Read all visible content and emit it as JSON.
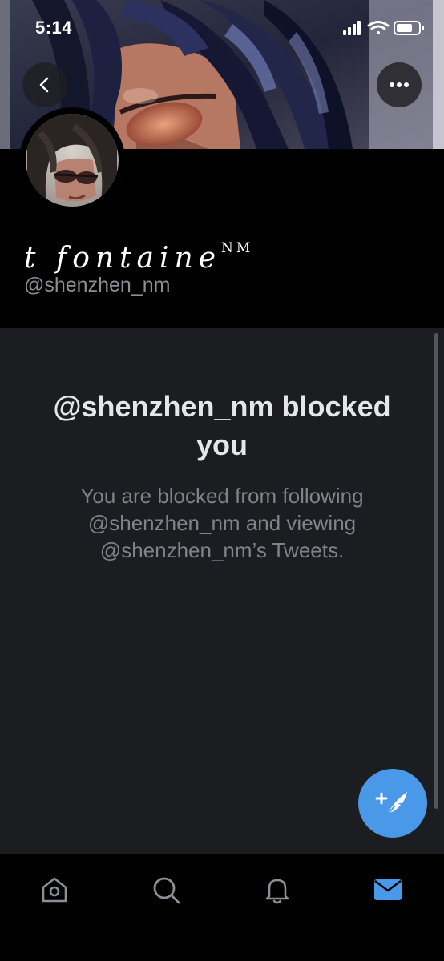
{
  "status_bar": {
    "time": "5:14",
    "icons": [
      "signal-icon",
      "wifi-icon",
      "battery-icon"
    ]
  },
  "header": {
    "back_icon": "chevron-left-icon",
    "more_icon": "more-horizontal-icon"
  },
  "profile": {
    "display_name": "t fontaine",
    "display_name_superscript": "NM",
    "handle": "@shenzhen_nm"
  },
  "blocked": {
    "title": "@shenzhen_nm blocked you",
    "description": "You are blocked from following @shenzhen_nm and viewing @shenzhen_nm’s Tweets."
  },
  "compose": {
    "icon": "compose-tweet-icon"
  },
  "tab_bar": {
    "tabs": [
      {
        "icon": "home-icon"
      },
      {
        "icon": "search-icon"
      },
      {
        "icon": "bell-icon"
      },
      {
        "icon": "mail-icon",
        "active": true
      }
    ]
  },
  "colors": {
    "background": "#000000",
    "panel": "#1c1d21",
    "accent": "#4a99e8",
    "secondary_text": "#8b8f96",
    "icon_inactive": "#8b8f96"
  }
}
